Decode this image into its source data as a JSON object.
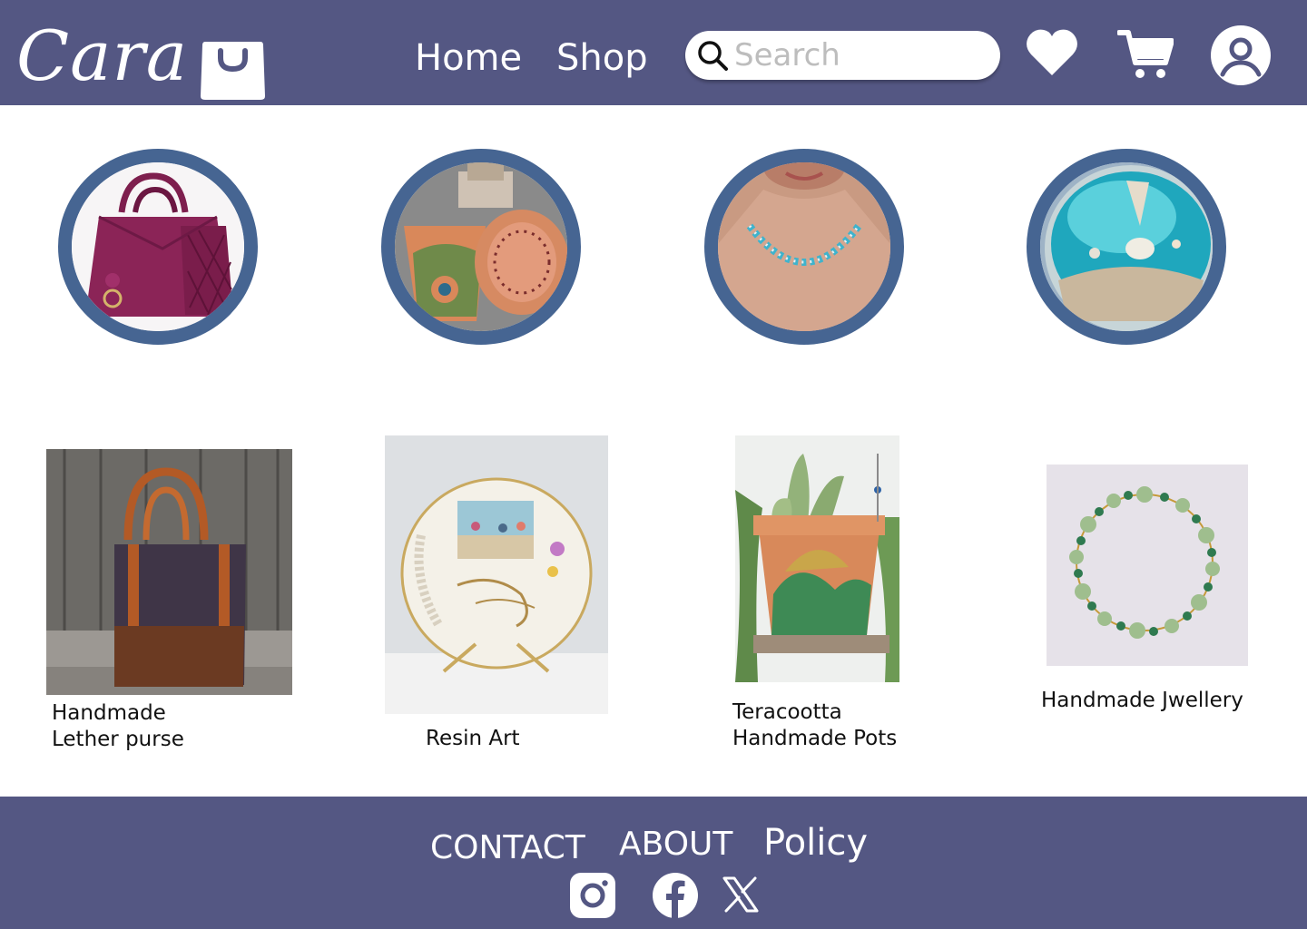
{
  "header": {
    "logo_text": "Cara",
    "nav": {
      "home": "Home",
      "shop": "Shop"
    },
    "search": {
      "placeholder": "Search",
      "value": ""
    },
    "icons": [
      "search-icon",
      "heart-icon",
      "cart-icon",
      "user-icon",
      "shopping-bag-icon"
    ]
  },
  "categories": [
    {
      "image": "handbag"
    },
    {
      "image": "terracotta-pots"
    },
    {
      "image": "necklace"
    },
    {
      "image": "resin-coaster"
    }
  ],
  "products": [
    {
      "line1": "Handmade",
      "line2": "Lether purse"
    },
    {
      "line1": "",
      "line2": "Resin Art"
    },
    {
      "line1": "Teracootta",
      "line2": "Handmade Pots"
    },
    {
      "line1": "Handmade Jwellery",
      "line2": ""
    }
  ],
  "footer": {
    "contact": "CONTACT",
    "about": "ABOUT",
    "policy": "Policy",
    "social": [
      "instagram-icon",
      "facebook-icon",
      "x-icon"
    ]
  },
  "colors": {
    "header_bg": "#545783",
    "circle_border": "#466592",
    "white": "#ffffff"
  }
}
